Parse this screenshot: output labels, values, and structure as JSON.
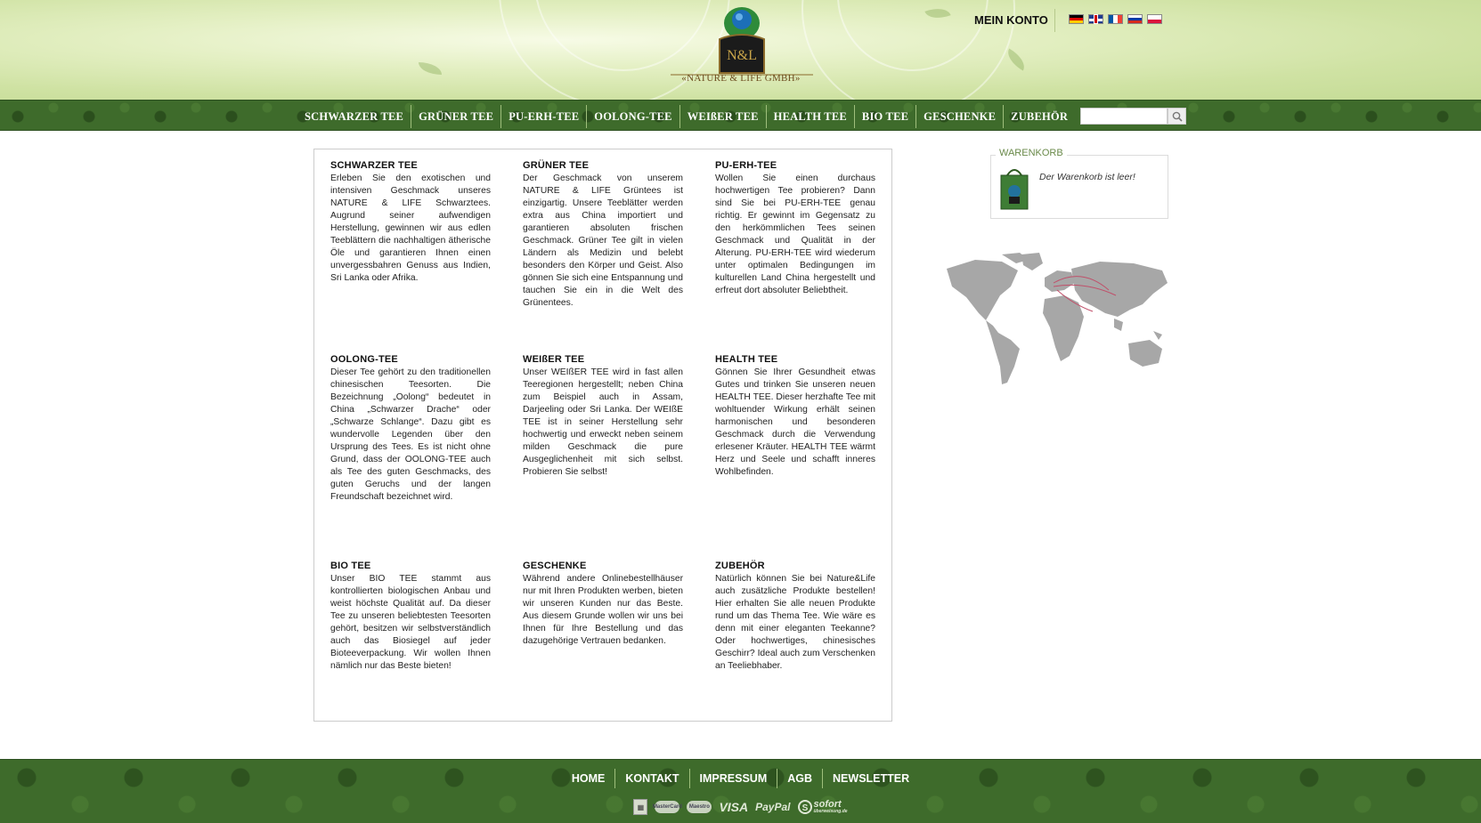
{
  "header": {
    "logo_text": "«NATURE & LIFE GMBH»",
    "logo_monogram": "N&L",
    "account_label": "MEIN KONTO",
    "languages": [
      "de",
      "gb",
      "fr",
      "ru",
      "pl"
    ]
  },
  "nav": {
    "items": [
      "SCHWARZER TEE",
      "GRÜNER TEE",
      "PU-ERH-TEE",
      "OOLONG-TEE",
      "WEIßER TEE",
      "HEALTH TEE",
      "BIO TEE",
      "GESCHENKE",
      "ZUBEHÖR"
    ],
    "search_placeholder": "",
    "search_icon": "magnifier-icon"
  },
  "categories": [
    {
      "title": "SCHWARZER TEE",
      "text": "Erleben Sie den exotischen und intensiven Geschmack unseres NATURE & LIFE Schwarztees. Augrund seiner aufwendigen Herstellung, gewinnen wir aus edlen Teeblättern die nachhaltigen ätherische Öle und garantieren Ihnen einen unvergessbahren Genuss aus Indien, Sri Lanka oder Afrika."
    },
    {
      "title": "GRÜNER TEE",
      "text": "Der Geschmack von unserem NATURE & LIFE Grüntees ist einzigartig. Unsere Teeblätter werden extra aus China importiert und garantieren absoluten frischen Geschmack. Grüner Tee gilt in vielen Ländern als Medizin und belebt besonders den Körper und Geist. Also gönnen Sie sich eine Entspannung und tauchen Sie ein in die Welt des Grünentees."
    },
    {
      "title": "PU-ERH-TEE",
      "text": "Wollen Sie einen durchaus hochwertigen Tee probieren? Dann sind Sie bei PU-ERH-TEE genau richtig. Er gewinnt im Gegensatz zu den herkömmlichen Tees seinen Geschmack und Qualität in der Alterung. PU-ERH-TEE wird wiederum unter optimalen Bedingungen im kulturellen Land China hergestellt und erfreut dort absoluter Beliebtheit."
    },
    {
      "title": "OOLONG-TEE",
      "text": "Dieser Tee gehört zu den traditionellen chinesischen Teesorten. Die Bezeichnung „Oolong“ bedeutet in China „Schwarzer Drache“ oder „Schwarze Schlange“. Dazu gibt es wundervolle Legenden über den Ursprung des Tees. Es ist nicht ohne Grund, dass der OOLONG-TEE auch als Tee des guten Geschmacks, des guten Geruchs und der langen Freundschaft bezeichnet wird."
    },
    {
      "title": "WEIßER TEE",
      "text": "Unser WEIßER TEE wird in fast allen Teeregionen hergestellt; neben China zum Beispiel auch in Assam, Darjeeling oder Sri Lanka. Der WEIßE TEE ist in seiner Herstellung sehr hochwertig und erweckt neben seinem milden Geschmack die pure Ausgeglichenheit mit sich selbst. Probieren Sie selbst!"
    },
    {
      "title": "HEALTH TEE",
      "text": "Gönnen Sie Ihrer Gesundheit etwas Gutes und trinken Sie unseren neuen HEALTH TEE. Dieser herzhafte Tee mit wohltuender Wirkung erhält seinen harmonischen und besonderen Geschmack durch die Verwendung erlesener Kräuter. HEALTH TEE wärmt Herz und Seele und schafft inneres Wohlbefinden."
    },
    {
      "title": "BIO TEE",
      "text": "Unser BIO TEE stammt aus kontrollierten biologischen Anbau und weist höchste Qualität auf. Da dieser Tee zu unseren beliebtesten Teesorten gehört, besitzen wir selbstverständlich auch das Biosiegel auf jeder Bioteeverpackung. Wir wollen Ihnen nämlich nur das Beste bieten!"
    },
    {
      "title": "GESCHENKE",
      "text": "Während andere Onlinebestellhäuser nur mit Ihren Produkten werben, bieten wir unseren Kunden nur das Beste. Aus diesem Grunde wollen wir uns bei Ihnen für Ihre Bestellung und das dazugehörige Vertrauen bedanken."
    },
    {
      "title": "ZUBEHÖR",
      "text": "Natürlich können Sie bei Nature&Life auch zusätzliche Produkte bestellen! Hier erhalten Sie alle neuen Produkte rund um das Thema Tee. Wie wäre es denn mit einer eleganten Teekanne? Oder hochwertiges, chinesisches Geschirr? Ideal auch zum Verschenken an Teeliebhaber."
    }
  ],
  "sidebar": {
    "cart_title": "WARENKORB",
    "cart_empty": "Der Warenkorb ist leer!",
    "cart_icon": "shopping-bag-icon",
    "map_icon": "world-map"
  },
  "footer": {
    "links": [
      "HOME",
      "KONTAKT",
      "IMPRESSUM",
      "AGB",
      "NEWSLETTER"
    ],
    "payments": {
      "visa": "VISA",
      "paypal": "PayPal",
      "sofort": "sofort",
      "sofort_sub": "überweisung.de",
      "mastercard": "MasterCard",
      "maestro": "Maestro"
    }
  },
  "colors": {
    "nav_green": "#3e6b2b",
    "header_green": "#cfe2a3",
    "cart_label": "#6a8a4a"
  }
}
